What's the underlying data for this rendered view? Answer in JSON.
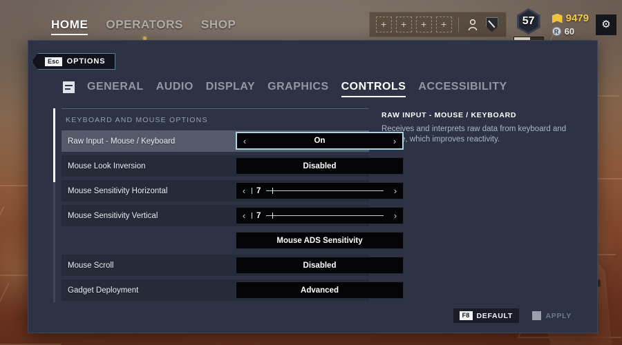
{
  "topnav": {
    "items": [
      {
        "label": "HOME",
        "active": true,
        "dot": false
      },
      {
        "label": "OPERATORS",
        "active": false,
        "dot": true
      },
      {
        "label": "SHOP",
        "active": false,
        "dot": false
      }
    ]
  },
  "hud": {
    "slot_glyph": "+",
    "slot_count": 4,
    "person_icon": "person-icon",
    "shield_icon": "shield-icon",
    "level": "57",
    "level_progress_pct": 55,
    "renown": "9479",
    "credits": "60",
    "credit_glyph": "R",
    "settings_glyph": "⚙"
  },
  "back": {
    "key": "Esc",
    "label": "OPTIONS"
  },
  "tabs": [
    {
      "label": "GENERAL",
      "active": false
    },
    {
      "label": "AUDIO",
      "active": false
    },
    {
      "label": "DISPLAY",
      "active": false
    },
    {
      "label": "GRAPHICS",
      "active": false
    },
    {
      "label": "CONTROLS",
      "active": true
    },
    {
      "label": "ACCESSIBILITY",
      "active": false
    }
  ],
  "section": {
    "title": "KEYBOARD AND MOUSE OPTIONS"
  },
  "rows": [
    {
      "label": "Raw Input - Mouse / Keyboard",
      "type": "stepper",
      "value": "On",
      "selected": true,
      "left_arrow": "‹",
      "right_arrow": "›"
    },
    {
      "label": "Mouse Look Inversion",
      "type": "plain",
      "value": "Disabled",
      "selected": false
    },
    {
      "label": "Mouse Sensitivity Horizontal",
      "type": "slider",
      "value": "7",
      "slider_pct": 6,
      "selected": false,
      "left_arrow": "‹",
      "right_arrow": "›"
    },
    {
      "label": "Mouse Sensitivity Vertical",
      "type": "slider",
      "value": "7",
      "slider_pct": 6,
      "selected": false,
      "left_arrow": "‹",
      "right_arrow": "›"
    },
    {
      "label": "",
      "type": "plain",
      "value": "Mouse ADS Sensitivity",
      "selected": false,
      "spacer": true
    },
    {
      "label": "Mouse Scroll",
      "type": "plain",
      "value": "Disabled",
      "selected": false
    },
    {
      "label": "Gadget Deployment",
      "type": "plain",
      "value": "Advanced",
      "selected": false
    }
  ],
  "info": {
    "title": "RAW INPUT - MOUSE / KEYBOARD",
    "description": "Receives and interprets raw data from keyboard and mouse, which improves reactivity."
  },
  "footer": {
    "default_key": "F8",
    "default_label": "DEFAULT",
    "apply_label": "APPLY"
  },
  "colors": {
    "selection_border": "#a9d4e6",
    "panel_bg": "#2d3244",
    "row_bg": "#262b3a",
    "row_selected_bg": "#555b6b",
    "accent_gold": "#f4c944"
  }
}
